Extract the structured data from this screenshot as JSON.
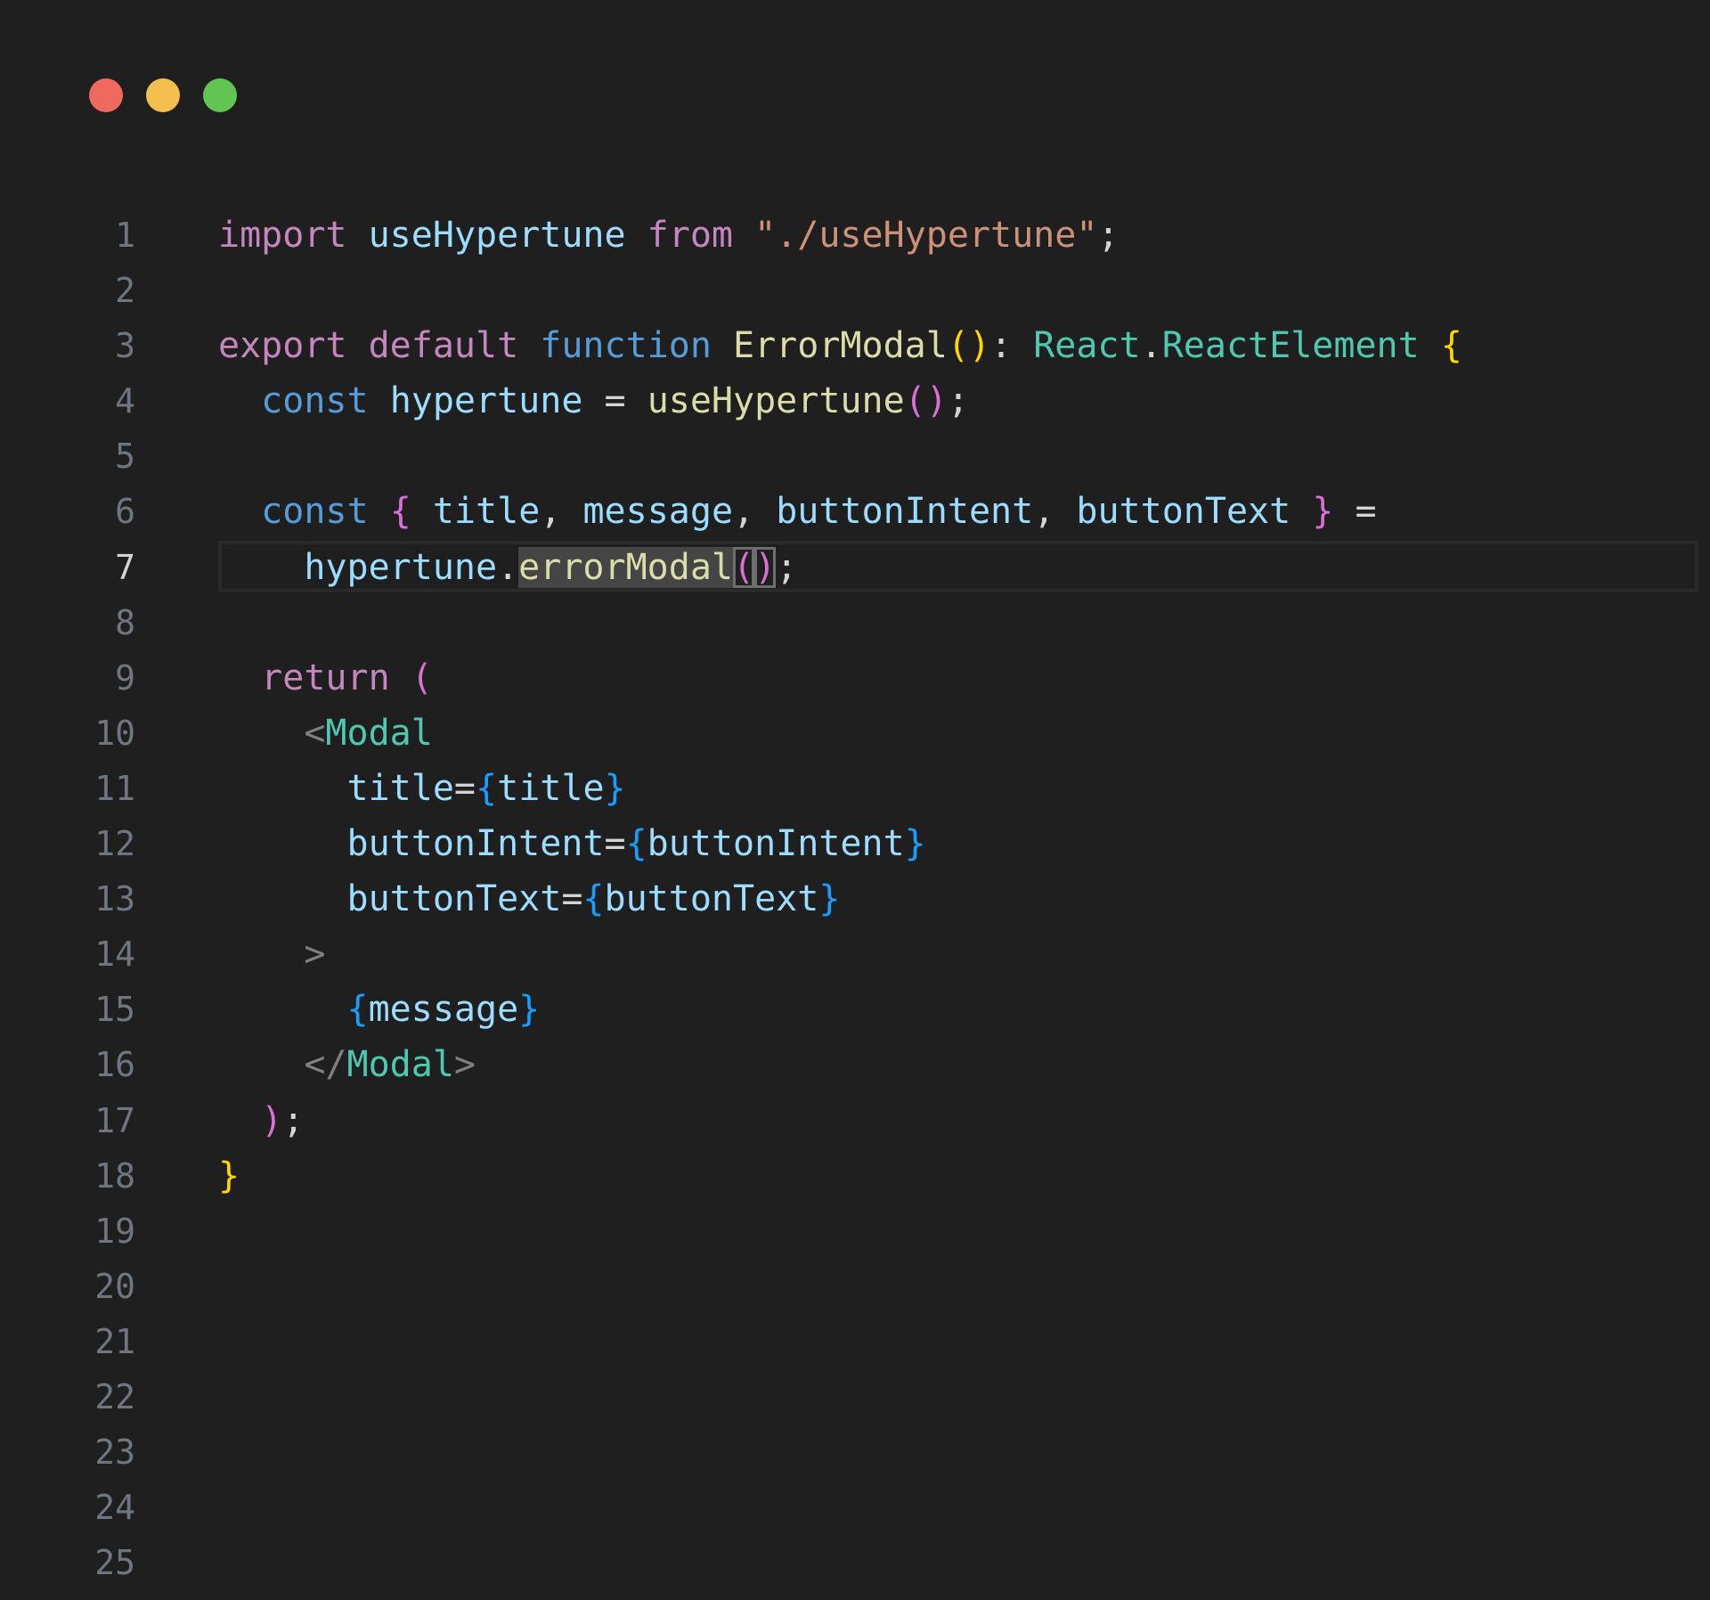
{
  "window": {
    "controls": {
      "close_color": "#ee6a5f",
      "minimize_color": "#f5bf4f",
      "maximize_color": "#61c554"
    }
  },
  "editor": {
    "active_line": 7,
    "selected_token": "errorModal",
    "lines": [
      {
        "n": "1",
        "tokens": [
          [
            "import",
            "kw-ctl"
          ],
          [
            " ",
            "punc"
          ],
          [
            "useHypertune",
            "var"
          ],
          [
            " ",
            "punc"
          ],
          [
            "from",
            "kw-ctl"
          ],
          [
            " ",
            "punc"
          ],
          [
            "\"./useHypertune\"",
            "str"
          ],
          [
            ";",
            "punc"
          ]
        ]
      },
      {
        "n": "2",
        "tokens": []
      },
      {
        "n": "3",
        "tokens": [
          [
            "export",
            "kw-ctl"
          ],
          [
            " ",
            "punc"
          ],
          [
            "default",
            "kw-ctl"
          ],
          [
            " ",
            "punc"
          ],
          [
            "function",
            "kw"
          ],
          [
            " ",
            "punc"
          ],
          [
            "ErrorModal",
            "fn"
          ],
          [
            "()",
            "br1"
          ],
          [
            ": ",
            "punc"
          ],
          [
            "React",
            "type"
          ],
          [
            ".",
            "punc"
          ],
          [
            "ReactElement",
            "type"
          ],
          [
            " ",
            "punc"
          ],
          [
            "{",
            "br1"
          ]
        ]
      },
      {
        "n": "4",
        "tokens": [
          [
            "  ",
            "punc"
          ],
          [
            "const",
            "kw"
          ],
          [
            " ",
            "punc"
          ],
          [
            "hypertune",
            "var"
          ],
          [
            " = ",
            "punc"
          ],
          [
            "useHypertune",
            "fn"
          ],
          [
            "()",
            "br2"
          ],
          [
            ";",
            "punc"
          ]
        ]
      },
      {
        "n": "5",
        "tokens": []
      },
      {
        "n": "6",
        "tokens": [
          [
            "  ",
            "punc"
          ],
          [
            "const",
            "kw"
          ],
          [
            " ",
            "punc"
          ],
          [
            "{",
            "br2"
          ],
          [
            " ",
            "punc"
          ],
          [
            "title",
            "var"
          ],
          [
            ", ",
            "punc"
          ],
          [
            "message",
            "var"
          ],
          [
            ", ",
            "punc"
          ],
          [
            "buttonIntent",
            "var"
          ],
          [
            ", ",
            "punc"
          ],
          [
            "buttonText",
            "var"
          ],
          [
            " ",
            "punc"
          ],
          [
            "}",
            "br2"
          ],
          [
            " =",
            "punc"
          ]
        ]
      },
      {
        "n": "7",
        "tokens": [
          [
            "    ",
            "punc"
          ],
          [
            "hypertune",
            "var"
          ],
          [
            ".",
            "punc"
          ],
          [
            "errorModal",
            "fn tok-selected"
          ],
          [
            "(",
            "br2 tok-cursor"
          ],
          [
            ")",
            "br2 tok-cursor"
          ],
          [
            ";",
            "punc"
          ]
        ]
      },
      {
        "n": "8",
        "tokens": []
      },
      {
        "n": "9",
        "tokens": [
          [
            "  ",
            "punc"
          ],
          [
            "return",
            "kw-ctl"
          ],
          [
            " ",
            "punc"
          ],
          [
            "(",
            "br2"
          ]
        ]
      },
      {
        "n": "10",
        "tokens": [
          [
            "    ",
            "punc"
          ],
          [
            "<",
            "tag-punc"
          ],
          [
            "Modal",
            "type"
          ]
        ]
      },
      {
        "n": "11",
        "tokens": [
          [
            "      ",
            "punc"
          ],
          [
            "title",
            "var"
          ],
          [
            "=",
            "punc"
          ],
          [
            "{",
            "br3"
          ],
          [
            "title",
            "var"
          ],
          [
            "}",
            "br3"
          ]
        ]
      },
      {
        "n": "12",
        "tokens": [
          [
            "      ",
            "punc"
          ],
          [
            "buttonIntent",
            "var"
          ],
          [
            "=",
            "punc"
          ],
          [
            "{",
            "br3"
          ],
          [
            "buttonIntent",
            "var"
          ],
          [
            "}",
            "br3"
          ]
        ]
      },
      {
        "n": "13",
        "tokens": [
          [
            "      ",
            "punc"
          ],
          [
            "buttonText",
            "var"
          ],
          [
            "=",
            "punc"
          ],
          [
            "{",
            "br3"
          ],
          [
            "buttonText",
            "var"
          ],
          [
            "}",
            "br3"
          ]
        ]
      },
      {
        "n": "14",
        "tokens": [
          [
            "    ",
            "punc"
          ],
          [
            ">",
            "tag-punc"
          ]
        ]
      },
      {
        "n": "15",
        "tokens": [
          [
            "      ",
            "punc"
          ],
          [
            "{",
            "br3"
          ],
          [
            "message",
            "var"
          ],
          [
            "}",
            "br3"
          ]
        ]
      },
      {
        "n": "16",
        "tokens": [
          [
            "    ",
            "punc"
          ],
          [
            "</",
            "tag-punc"
          ],
          [
            "Modal",
            "type"
          ],
          [
            ">",
            "tag-punc"
          ]
        ]
      },
      {
        "n": "17",
        "tokens": [
          [
            "  ",
            "punc"
          ],
          [
            ")",
            "br2"
          ],
          [
            ";",
            "punc"
          ]
        ]
      },
      {
        "n": "18",
        "tokens": [
          [
            "}",
            "br1"
          ]
        ]
      },
      {
        "n": "19",
        "tokens": []
      },
      {
        "n": "20",
        "tokens": []
      },
      {
        "n": "21",
        "tokens": []
      },
      {
        "n": "22",
        "tokens": []
      },
      {
        "n": "23",
        "tokens": []
      },
      {
        "n": "24",
        "tokens": []
      },
      {
        "n": "25",
        "tokens": []
      }
    ]
  }
}
